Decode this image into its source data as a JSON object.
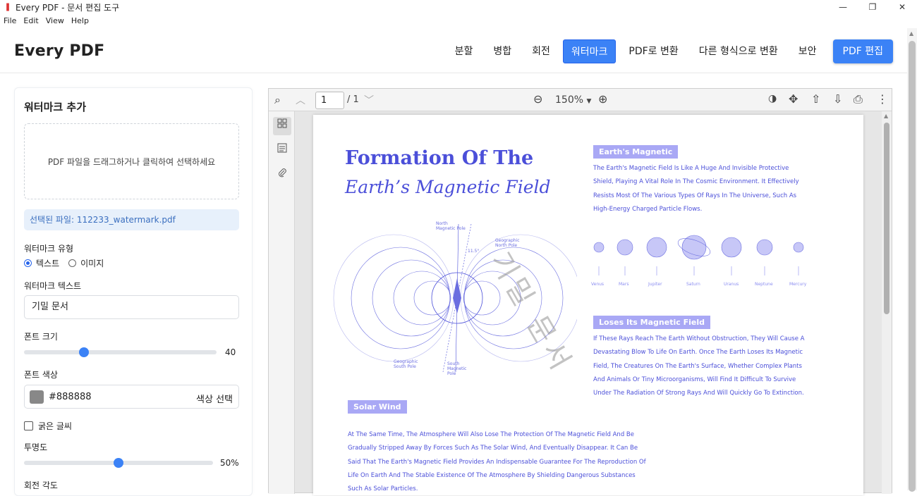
{
  "window": {
    "title": "Every PDF - 문서 편집 도구",
    "controls": {
      "minimize": "—",
      "maximize": "❐",
      "close": "✕"
    }
  },
  "menu": [
    "File",
    "Edit",
    "View",
    "Help"
  ],
  "header": {
    "logo": "Every PDF",
    "nav": [
      "분할",
      "병합",
      "회전",
      "워터마크",
      "PDF로 변환",
      "다른 형식으로 변환",
      "보안"
    ],
    "active_nav": "워터마크",
    "primary_button": "PDF 편집"
  },
  "sidebar": {
    "title": "워터마크 추가",
    "dropzone_text": "PDF 파일을 드래그하거나 클릭하여 선택하세요",
    "selected_file": "선택된 파일: 112233_watermark.pdf",
    "watermark_type_label": "워터마크 유형",
    "type_text": "텍스트",
    "type_image": "이미지",
    "selected_type": "텍스트",
    "watermark_text_label": "워터마크 텍스트",
    "watermark_text_value": "기밀 문서",
    "font_size_label": "폰트 크기",
    "font_size_value": "40",
    "font_size_fraction": 0.31,
    "font_color_label": "폰트 색상",
    "font_color_value": "#888888",
    "color_pick_label": "색상 선택",
    "bold_label": "굵은 글씨",
    "bold_checked": false,
    "opacity_label": "투명도",
    "opacity_value": "50%",
    "opacity_fraction": 0.5,
    "rotation_label": "회전 각도"
  },
  "viewer": {
    "page_current": "1",
    "page_total": "/ 1",
    "zoom": "150%",
    "icons": {
      "search": "⌕",
      "prev": "︿",
      "next": "﹀",
      "zoom_out": "⊖",
      "zoom_in": "⊕",
      "rotate": "◑",
      "move": "✥",
      "upload": "⇧",
      "download": "⇩",
      "print": "⎙",
      "more": "⋮"
    }
  },
  "document": {
    "title_line1": "Formation Of The",
    "title_line2": "Earth’s Magnetic Field",
    "section1_tag": "Earth's Magnetic",
    "section1_text": "The Earth's Magnetic Field Is Like A Huge And Invisible Protective Shield, Playing A Vital Role In The Cosmic Environment. It Effectively Resists Most Of The Various Types Of Rays In The Universe, Such As High-Energy Charged Particle Flows.",
    "planets": [
      "Venus",
      "Mars",
      "Jupiter",
      "Saturn",
      "Uranus",
      "Neptune",
      "Mercury"
    ],
    "section2_tag": "Loses Its Magnetic Field",
    "section2_text": "If These Rays Reach The Earth Without Obstruction, They Will Cause A Devastating Blow To Life On Earth. Once The Earth Loses Its Magnetic Field, The Creatures On The Earth's Surface, Whether Complex Plants And Animals Or Tiny Microorganisms, Will Find It Difficult To Survive Under The Radiation Of Strong Rays And Will Quickly Go To Extinction.",
    "section3_tag": "Solar Wind",
    "section3_text": "At The Same Time, The Atmosphere Will Also Lose The Protection Of The Magnetic Field And Be Gradually Stripped Away By Forces Such As The Solar Wind, And Eventually Disappear. It Can Be Said That The Earth's Magnetic Field Provides An Indispensable Guarantee For The Reproduction Of Life On Earth And The Stable Existence Of The Atmosphere By Shielding Dangerous Substances Such As Solar Particles.",
    "diagram_labels": {
      "north_magnetic": "North\nMagnetic Pole",
      "geographic_north": "Geographic\nNorth Pole",
      "angle": "11.5°",
      "geographic_south": "Geographic\nSouth Pole",
      "south_magnetic": "South\nMagnetic\nPole"
    },
    "watermark": "기밀 문서"
  }
}
